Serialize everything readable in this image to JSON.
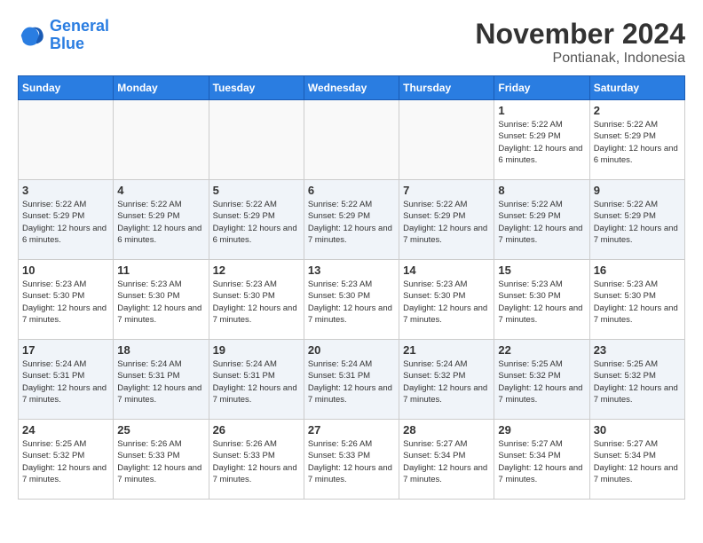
{
  "logo": {
    "text_general": "General",
    "text_blue": "Blue"
  },
  "header": {
    "month": "November 2024",
    "location": "Pontianak, Indonesia"
  },
  "weekdays": [
    "Sunday",
    "Monday",
    "Tuesday",
    "Wednesday",
    "Thursday",
    "Friday",
    "Saturday"
  ],
  "weeks": [
    [
      {
        "day": "",
        "info": ""
      },
      {
        "day": "",
        "info": ""
      },
      {
        "day": "",
        "info": ""
      },
      {
        "day": "",
        "info": ""
      },
      {
        "day": "",
        "info": ""
      },
      {
        "day": "1",
        "info": "Sunrise: 5:22 AM\nSunset: 5:29 PM\nDaylight: 12 hours and 6 minutes."
      },
      {
        "day": "2",
        "info": "Sunrise: 5:22 AM\nSunset: 5:29 PM\nDaylight: 12 hours and 6 minutes."
      }
    ],
    [
      {
        "day": "3",
        "info": "Sunrise: 5:22 AM\nSunset: 5:29 PM\nDaylight: 12 hours and 6 minutes."
      },
      {
        "day": "4",
        "info": "Sunrise: 5:22 AM\nSunset: 5:29 PM\nDaylight: 12 hours and 6 minutes."
      },
      {
        "day": "5",
        "info": "Sunrise: 5:22 AM\nSunset: 5:29 PM\nDaylight: 12 hours and 6 minutes."
      },
      {
        "day": "6",
        "info": "Sunrise: 5:22 AM\nSunset: 5:29 PM\nDaylight: 12 hours and 7 minutes."
      },
      {
        "day": "7",
        "info": "Sunrise: 5:22 AM\nSunset: 5:29 PM\nDaylight: 12 hours and 7 minutes."
      },
      {
        "day": "8",
        "info": "Sunrise: 5:22 AM\nSunset: 5:29 PM\nDaylight: 12 hours and 7 minutes."
      },
      {
        "day": "9",
        "info": "Sunrise: 5:22 AM\nSunset: 5:29 PM\nDaylight: 12 hours and 7 minutes."
      }
    ],
    [
      {
        "day": "10",
        "info": "Sunrise: 5:23 AM\nSunset: 5:30 PM\nDaylight: 12 hours and 7 minutes."
      },
      {
        "day": "11",
        "info": "Sunrise: 5:23 AM\nSunset: 5:30 PM\nDaylight: 12 hours and 7 minutes."
      },
      {
        "day": "12",
        "info": "Sunrise: 5:23 AM\nSunset: 5:30 PM\nDaylight: 12 hours and 7 minutes."
      },
      {
        "day": "13",
        "info": "Sunrise: 5:23 AM\nSunset: 5:30 PM\nDaylight: 12 hours and 7 minutes."
      },
      {
        "day": "14",
        "info": "Sunrise: 5:23 AM\nSunset: 5:30 PM\nDaylight: 12 hours and 7 minutes."
      },
      {
        "day": "15",
        "info": "Sunrise: 5:23 AM\nSunset: 5:30 PM\nDaylight: 12 hours and 7 minutes."
      },
      {
        "day": "16",
        "info": "Sunrise: 5:23 AM\nSunset: 5:30 PM\nDaylight: 12 hours and 7 minutes."
      }
    ],
    [
      {
        "day": "17",
        "info": "Sunrise: 5:24 AM\nSunset: 5:31 PM\nDaylight: 12 hours and 7 minutes."
      },
      {
        "day": "18",
        "info": "Sunrise: 5:24 AM\nSunset: 5:31 PM\nDaylight: 12 hours and 7 minutes."
      },
      {
        "day": "19",
        "info": "Sunrise: 5:24 AM\nSunset: 5:31 PM\nDaylight: 12 hours and 7 minutes."
      },
      {
        "day": "20",
        "info": "Sunrise: 5:24 AM\nSunset: 5:31 PM\nDaylight: 12 hours and 7 minutes."
      },
      {
        "day": "21",
        "info": "Sunrise: 5:24 AM\nSunset: 5:32 PM\nDaylight: 12 hours and 7 minutes."
      },
      {
        "day": "22",
        "info": "Sunrise: 5:25 AM\nSunset: 5:32 PM\nDaylight: 12 hours and 7 minutes."
      },
      {
        "day": "23",
        "info": "Sunrise: 5:25 AM\nSunset: 5:32 PM\nDaylight: 12 hours and 7 minutes."
      }
    ],
    [
      {
        "day": "24",
        "info": "Sunrise: 5:25 AM\nSunset: 5:32 PM\nDaylight: 12 hours and 7 minutes."
      },
      {
        "day": "25",
        "info": "Sunrise: 5:26 AM\nSunset: 5:33 PM\nDaylight: 12 hours and 7 minutes."
      },
      {
        "day": "26",
        "info": "Sunrise: 5:26 AM\nSunset: 5:33 PM\nDaylight: 12 hours and 7 minutes."
      },
      {
        "day": "27",
        "info": "Sunrise: 5:26 AM\nSunset: 5:33 PM\nDaylight: 12 hours and 7 minutes."
      },
      {
        "day": "28",
        "info": "Sunrise: 5:27 AM\nSunset: 5:34 PM\nDaylight: 12 hours and 7 minutes."
      },
      {
        "day": "29",
        "info": "Sunrise: 5:27 AM\nSunset: 5:34 PM\nDaylight: 12 hours and 7 minutes."
      },
      {
        "day": "30",
        "info": "Sunrise: 5:27 AM\nSunset: 5:34 PM\nDaylight: 12 hours and 7 minutes."
      }
    ]
  ]
}
